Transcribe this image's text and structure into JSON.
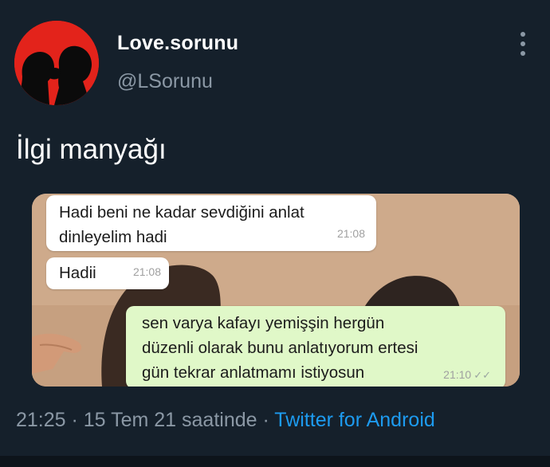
{
  "tweet": {
    "display_name": "Love.sorunu",
    "handle": "@LSorunu",
    "text": "İlgi manyağı",
    "time": "21:25",
    "separator": " · ",
    "date": "15 Tem 21 saatinde",
    "source": "Twitter for Android",
    "menu_icon": "more-vertical-icon"
  },
  "chat": {
    "messages": [
      {
        "text": "Hadi beni ne kadar sevdiğini anlat\ndinleyelim hadi",
        "time": "21:08",
        "side": "incoming"
      },
      {
        "text": "Hadii",
        "time": "21:08",
        "side": "incoming"
      },
      {
        "text": "sen varya kafayı yemişşin hergün\ndüzenli olarak bunu anlatıyorum ertesi\ngün tekrar anlatmamı istiyosun",
        "time": "21:10",
        "side": "outgoing",
        "status": "double-check"
      }
    ]
  },
  "colors": {
    "background": "#15202b",
    "primary_text": "#ffffff",
    "secondary_text": "#8b98a5",
    "link": "#1d9bf0",
    "avatar_bg": "#e3231b",
    "incoming_bubble": "#ffffff",
    "outgoing_bubble": "#e0f8c8"
  }
}
